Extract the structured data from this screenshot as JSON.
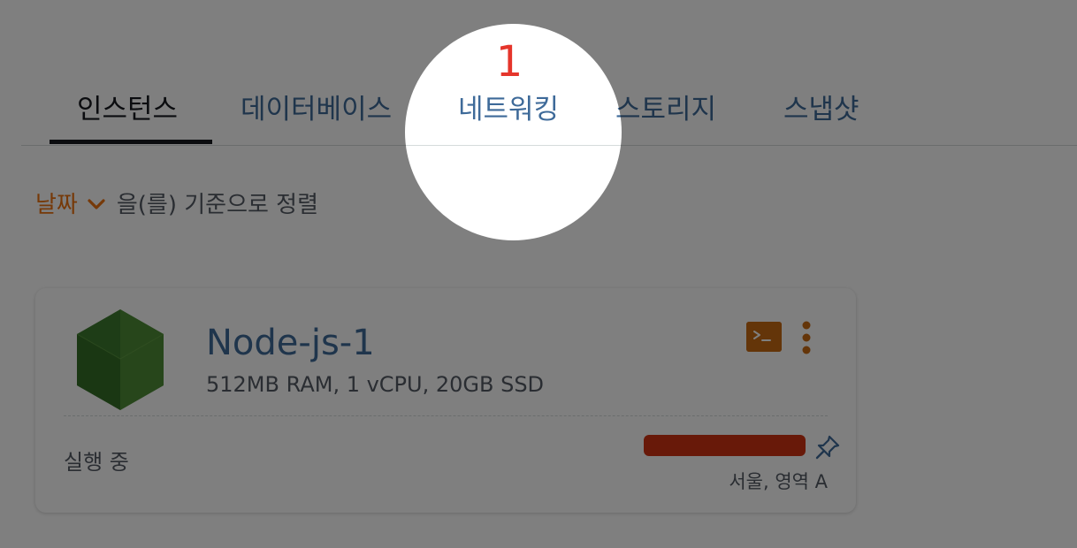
{
  "tabs": [
    {
      "label": "인스턴스",
      "active": true
    },
    {
      "label": "데이터베이스",
      "active": false
    },
    {
      "label": "네트워킹",
      "active": false
    },
    {
      "label": "스토리지",
      "active": false
    },
    {
      "label": "스냅샷",
      "active": false
    }
  ],
  "sort": {
    "field": "날짜",
    "suffix": "을(를) 기준으로 정렬"
  },
  "instance": {
    "name": "Node-js-1",
    "specs": "512MB RAM, 1 vCPU, 20GB SSD",
    "status": "실행 중",
    "region": "서울, 영역 A",
    "logo_icon": "nodejs-hexagon-icon",
    "terminal_icon": "terminal-icon",
    "menu_icon": "kebab-menu-icon",
    "pin_icon": "pin-icon"
  },
  "tutorial": {
    "step_number": "1"
  },
  "colors": {
    "accent_orange": "#ec7211",
    "link_blue": "#3e6a99",
    "text_dark": "#16191f",
    "text_secondary": "#545b64",
    "step_red": "#e5352b",
    "nodejs_green": "#3c7a2e",
    "redaction_red": "#d13212"
  }
}
